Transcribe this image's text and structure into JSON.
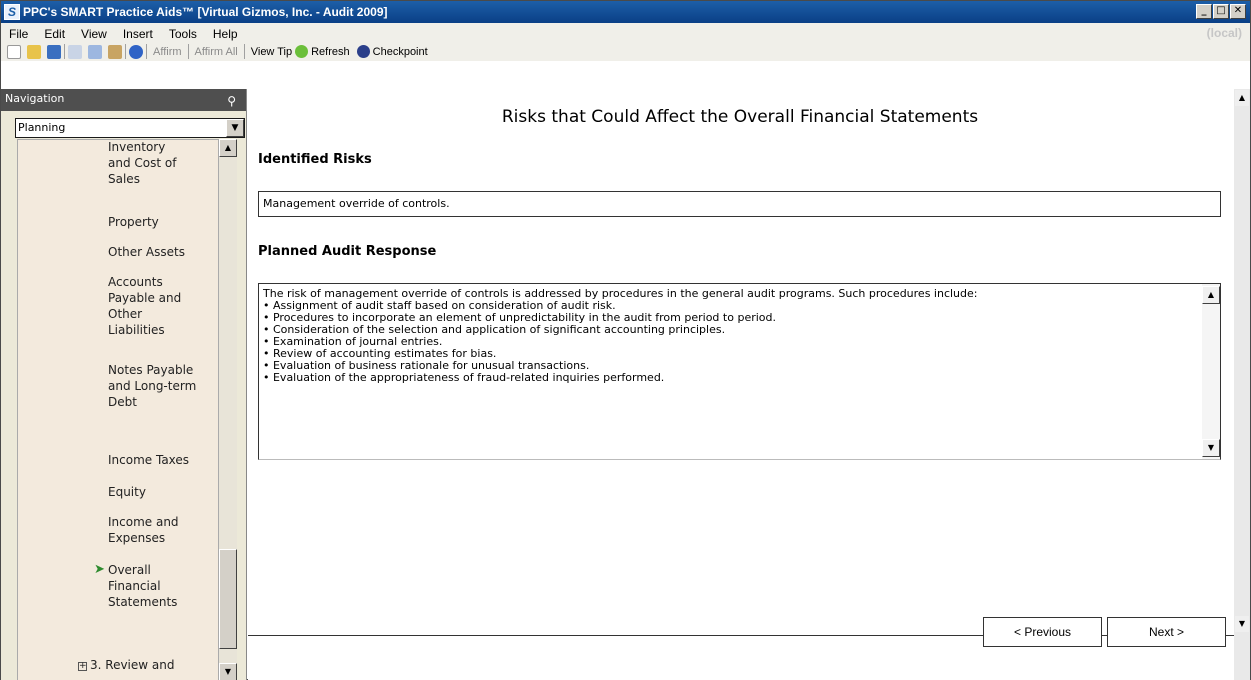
{
  "window": {
    "title": "PPC's SMART Practice Aids™ [Virtual Gizmos, Inc. - Audit 2009]",
    "app_icon": "S",
    "controls": [
      "_",
      "□",
      "✕"
    ]
  },
  "menubar": {
    "items": [
      "File",
      "Edit",
      "View",
      "Insert",
      "Tools",
      "Help"
    ],
    "server": "(local)"
  },
  "toolbar": {
    "affirm": "Affirm",
    "affirm_all": "Affirm All",
    "view_tip": "View Tip",
    "refresh": "Refresh",
    "checkpoint": "Checkpoint"
  },
  "navigation": {
    "header": "Navigation",
    "selected": "Planning",
    "items": [
      "Inventory and Cost of Sales",
      "Property",
      "Other Assets",
      "Accounts Payable and Other Liabilities",
      "Notes Payable and Long-term Debt",
      "Income Taxes",
      "Equity",
      "Income and Expenses",
      "Overall Financial Statements"
    ],
    "next_section": "3. Review and"
  },
  "page": {
    "title": "Risks that Could Affect the Overall Financial Statements",
    "identified_risks_label": "Identified Risks",
    "identified_risks_value": "Management override of controls.",
    "response_label": "Planned Audit Response",
    "response_lines": [
      "The risk of management override of controls is addressed by procedures in the general audit programs. Such procedures include:",
      "•  Assignment of audit staff based on consideration of audit risk.",
      "•  Procedures to incorporate an element of unpredictability in the audit from period to period.",
      "•  Consideration of the selection and application of significant accounting principles.",
      "•  Examination of journal entries.",
      "•  Review of accounting estimates for bias.",
      "•  Evaluation of business rationale for unusual transactions.",
      "•  Evaluation of the appropriateness of fraud-related inquiries performed."
    ]
  },
  "footer": {
    "previous": "< Previous",
    "next": "Next >"
  }
}
